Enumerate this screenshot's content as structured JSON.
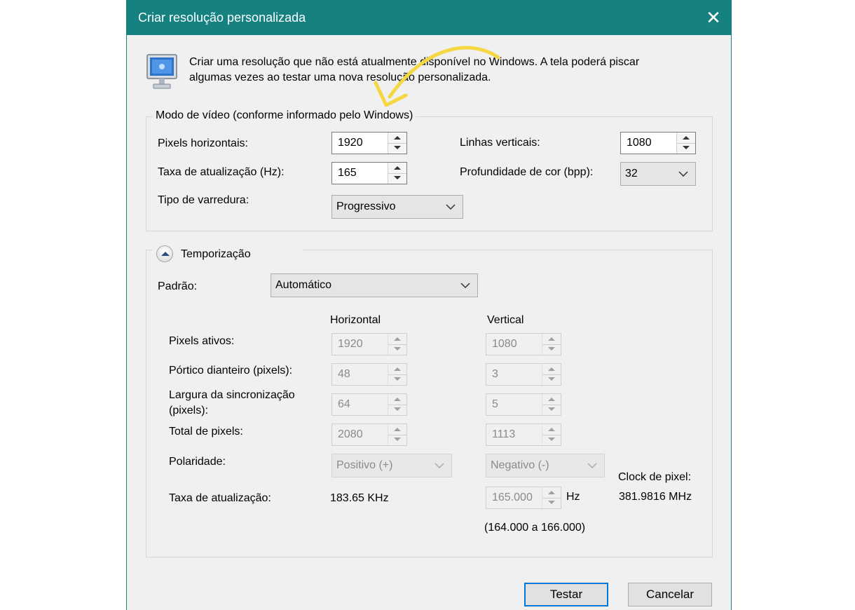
{
  "dialog": {
    "title": "Criar resolução personalizada",
    "close_glyph": "✕",
    "description_line1": "Criar uma resolução que não está atualmente disponível no Windows. A tela poderá piscar",
    "description_line2": "algumas vezes ao testar uma nova resolução personalizada.",
    "icon": "monitor-icon",
    "annotation": "yellow-curved-arrow"
  },
  "video_mode": {
    "legend": "Modo de vídeo (conforme informado pelo Windows)",
    "horizontal_pixels_label": "Pixels horizontais:",
    "horizontal_pixels_value": "1920",
    "vertical_lines_label": "Linhas verticais:",
    "vertical_lines_value": "1080",
    "refresh_rate_label": "Taxa de atualização (Hz):",
    "refresh_rate_value": "165",
    "color_depth_label": "Profundidade de cor (bpp):",
    "color_depth_value": "32",
    "scan_type_label": "Tipo de varredura:",
    "scan_type_value": "Progressivo"
  },
  "timing": {
    "legend": "Temporização",
    "standard_label": "Padrão:",
    "standard_value": "Automático",
    "horizontal_header": "Horizontal",
    "vertical_header": "Vertical",
    "active_pixels_label": "Pixels ativos:",
    "active_h": "1920",
    "active_v": "1080",
    "front_porch_label": "Pórtico dianteiro (pixels):",
    "front_h": "48",
    "front_v": "3",
    "sync_width_label_1": "Largura da sincronização",
    "sync_width_label_2": "(pixels):",
    "sync_h": "64",
    "sync_v": "5",
    "total_pixels_label": "Total de pixels:",
    "total_h": "2080",
    "total_v": "1113",
    "polarity_label": "Polaridade:",
    "polarity_h": "Positivo (+)",
    "polarity_v": "Negativo (-)",
    "refresh_rate_label": "Taxa de atualização:",
    "refresh_h": "183.65 KHz",
    "refresh_v": "165.000",
    "refresh_v_unit": "Hz",
    "refresh_range": "(164.000 a 166.000)",
    "pixel_clock_label": "Clock de pixel:",
    "pixel_clock_value": "381.9816 MHz"
  },
  "buttons": {
    "test": "Testar",
    "cancel": "Cancelar"
  },
  "colors": {
    "titlebar": "#168181",
    "accent": "#0078d7",
    "arrow": "#f5d742"
  }
}
